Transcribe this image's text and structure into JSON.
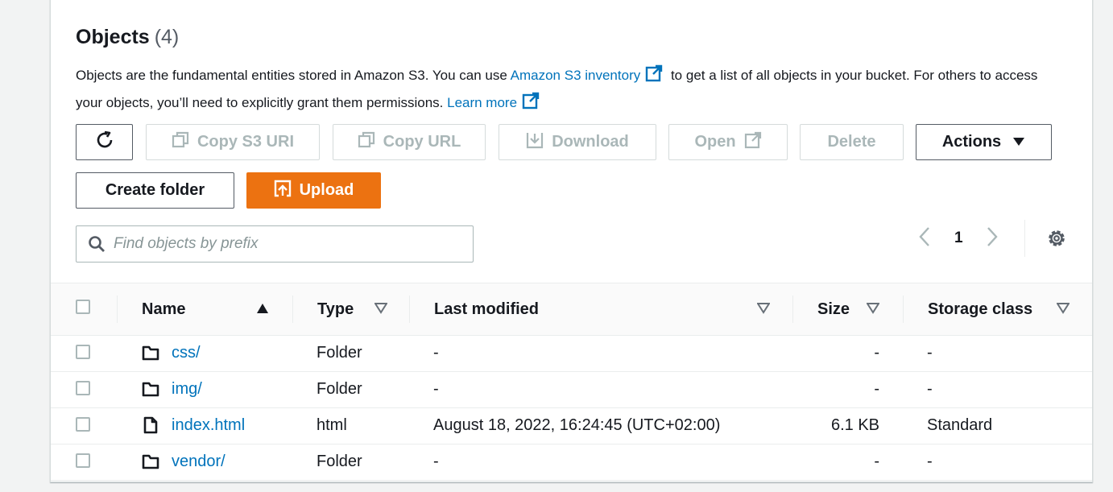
{
  "header": {
    "title": "Objects",
    "count": "(4)"
  },
  "description": {
    "part1": "Objects are the fundamental entities stored in Amazon S3. You can use ",
    "link1": "Amazon S3 inventory",
    "part2": " to get a list of all objects in your bucket. For others to access your objects, you’ll need to explicitly grant them permissions. ",
    "link2": "Learn more"
  },
  "toolbar": {
    "copy_s3_uri": "Copy S3 URI",
    "copy_url": "Copy URL",
    "download": "Download",
    "open": "Open",
    "delete": "Delete",
    "actions": "Actions",
    "create_folder": "Create folder",
    "upload": "Upload"
  },
  "search": {
    "placeholder": "Find objects by prefix",
    "value": ""
  },
  "pagination": {
    "page": "1"
  },
  "table": {
    "columns": [
      "Name",
      "Type",
      "Last modified",
      "Size",
      "Storage class"
    ],
    "rows": [
      {
        "icon": "folder-icon",
        "name": "css/",
        "type": "Folder",
        "modified": "-",
        "size": "-",
        "storage": "-"
      },
      {
        "icon": "folder-icon",
        "name": "img/",
        "type": "Folder",
        "modified": "-",
        "size": "-",
        "storage": "-"
      },
      {
        "icon": "file-icon",
        "name": "index.html",
        "type": "html",
        "modified": "August 18, 2022, 16:24:45 (UTC+02:00)",
        "size": "6.1 KB",
        "storage": "Standard"
      },
      {
        "icon": "folder-icon",
        "name": "vendor/",
        "type": "Folder",
        "modified": "-",
        "size": "-",
        "storage": "-"
      }
    ]
  },
  "colors": {
    "link": "#0073bb",
    "primary": "#ec7211",
    "disabled": "#aab7b8",
    "border": "#545b64"
  }
}
